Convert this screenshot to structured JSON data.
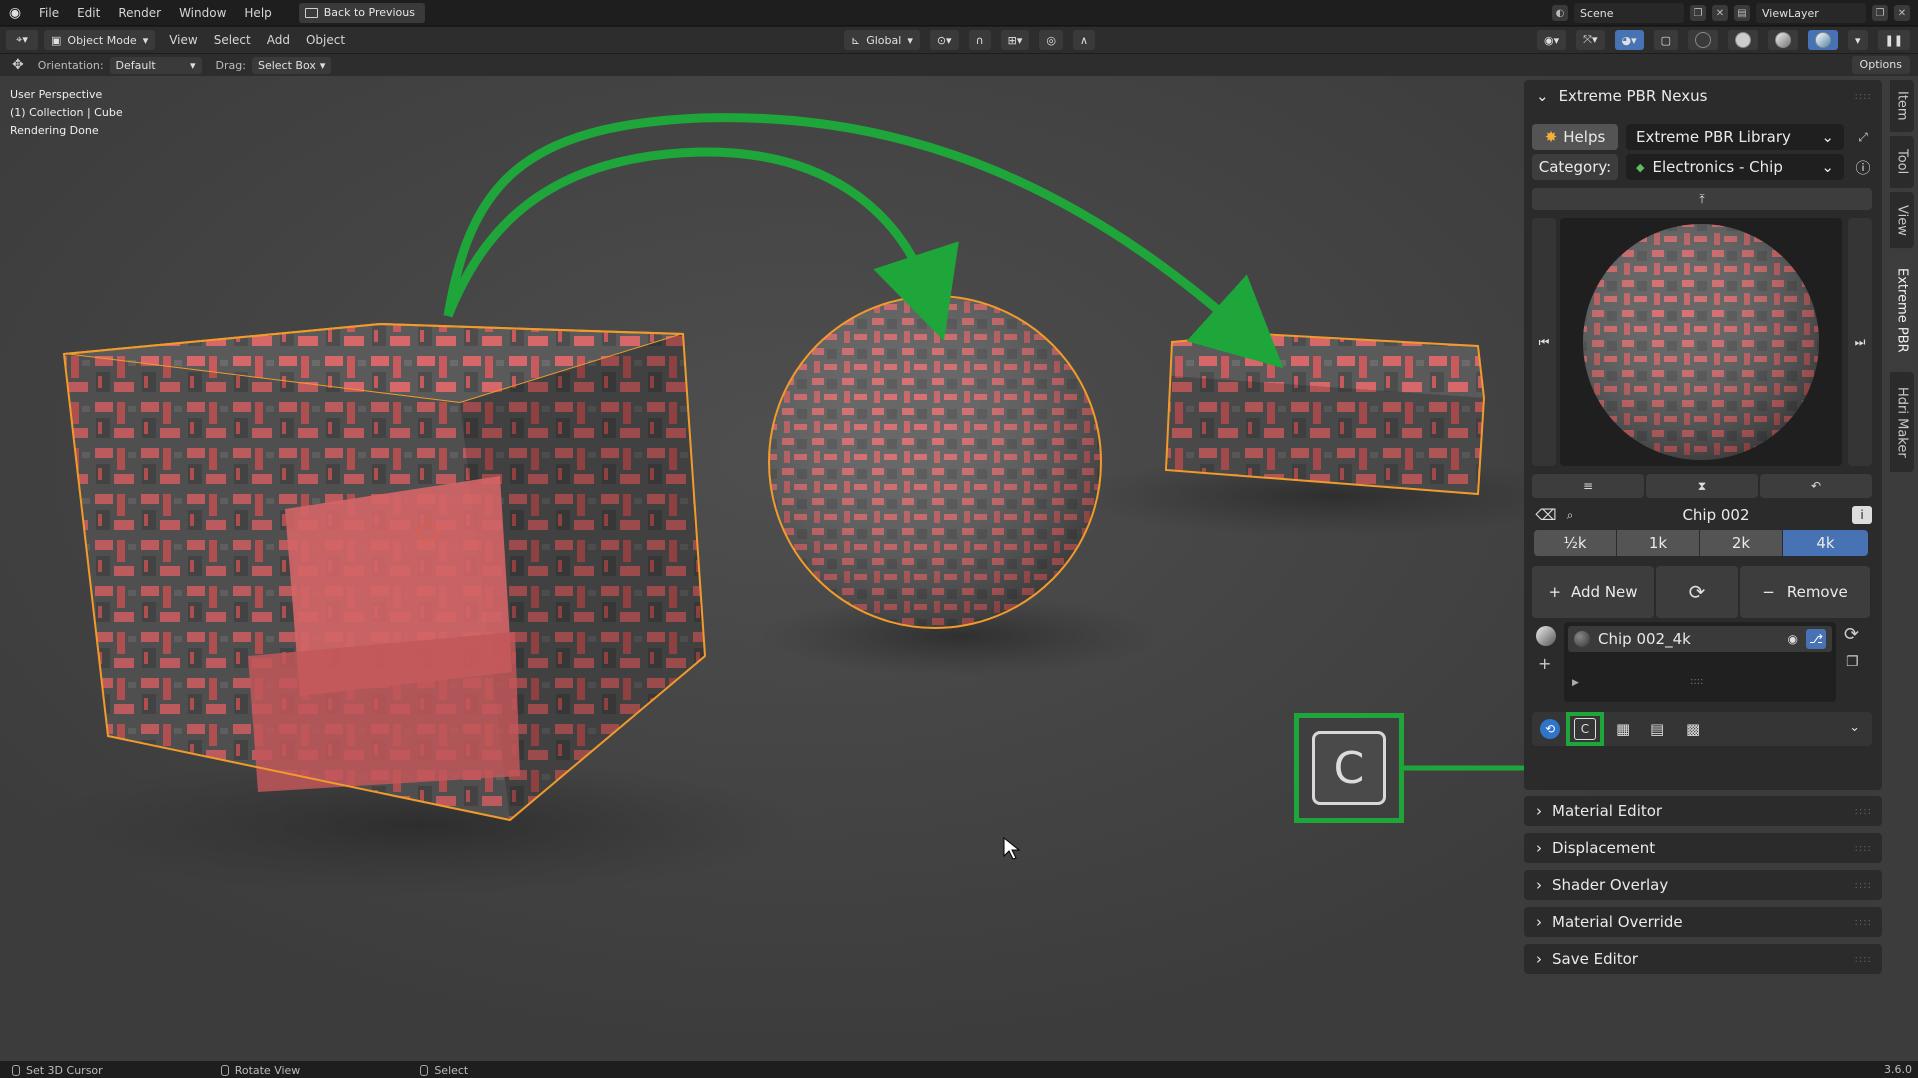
{
  "menubar": {
    "items": [
      "File",
      "Edit",
      "Render",
      "Window",
      "Help"
    ],
    "back_label": "Back to Previous",
    "scene_label": "Scene",
    "viewlayer_label": "ViewLayer"
  },
  "header": {
    "mode": "Object Mode",
    "menus": [
      "View",
      "Select",
      "Add",
      "Object"
    ],
    "transform": "Global"
  },
  "toolbar": {
    "orientation_label": "Orientation:",
    "orientation_value": "Default",
    "drag_label": "Drag:",
    "drag_value": "Select Box",
    "options_label": "Options"
  },
  "viewport": {
    "info_lines": [
      "User Perspective",
      "(1) Collection | Cube",
      "Rendering Done"
    ],
    "key_overlay": "C",
    "accent_green": "#1fa63a",
    "selection_orange": "#f29b2b"
  },
  "panel": {
    "title": "Extreme PBR Nexus",
    "helps_label": "Helps",
    "library_value": "Extreme PBR Library",
    "category_label": "Category:",
    "category_value": "Electronics - Chip",
    "material_name": "Chip 002",
    "resolutions": [
      "½k",
      "1k",
      "2k",
      "4k"
    ],
    "active_resolution": "4k",
    "add_new_label": "Add New",
    "remove_label": "Remove",
    "slot_name": "Chip 002_4k",
    "subpanels": [
      "Material Editor",
      "Displacement",
      "Shader Overlay",
      "Material Override",
      "Save Editor"
    ],
    "active_color": "#4772b3"
  },
  "side_tabs": [
    "Item",
    "Tool",
    "View",
    "Extreme PBR",
    "Hdri Maker"
  ],
  "status": {
    "items": [
      "Set 3D Cursor",
      "Rotate View",
      "Select"
    ],
    "version": "3.6.0"
  }
}
